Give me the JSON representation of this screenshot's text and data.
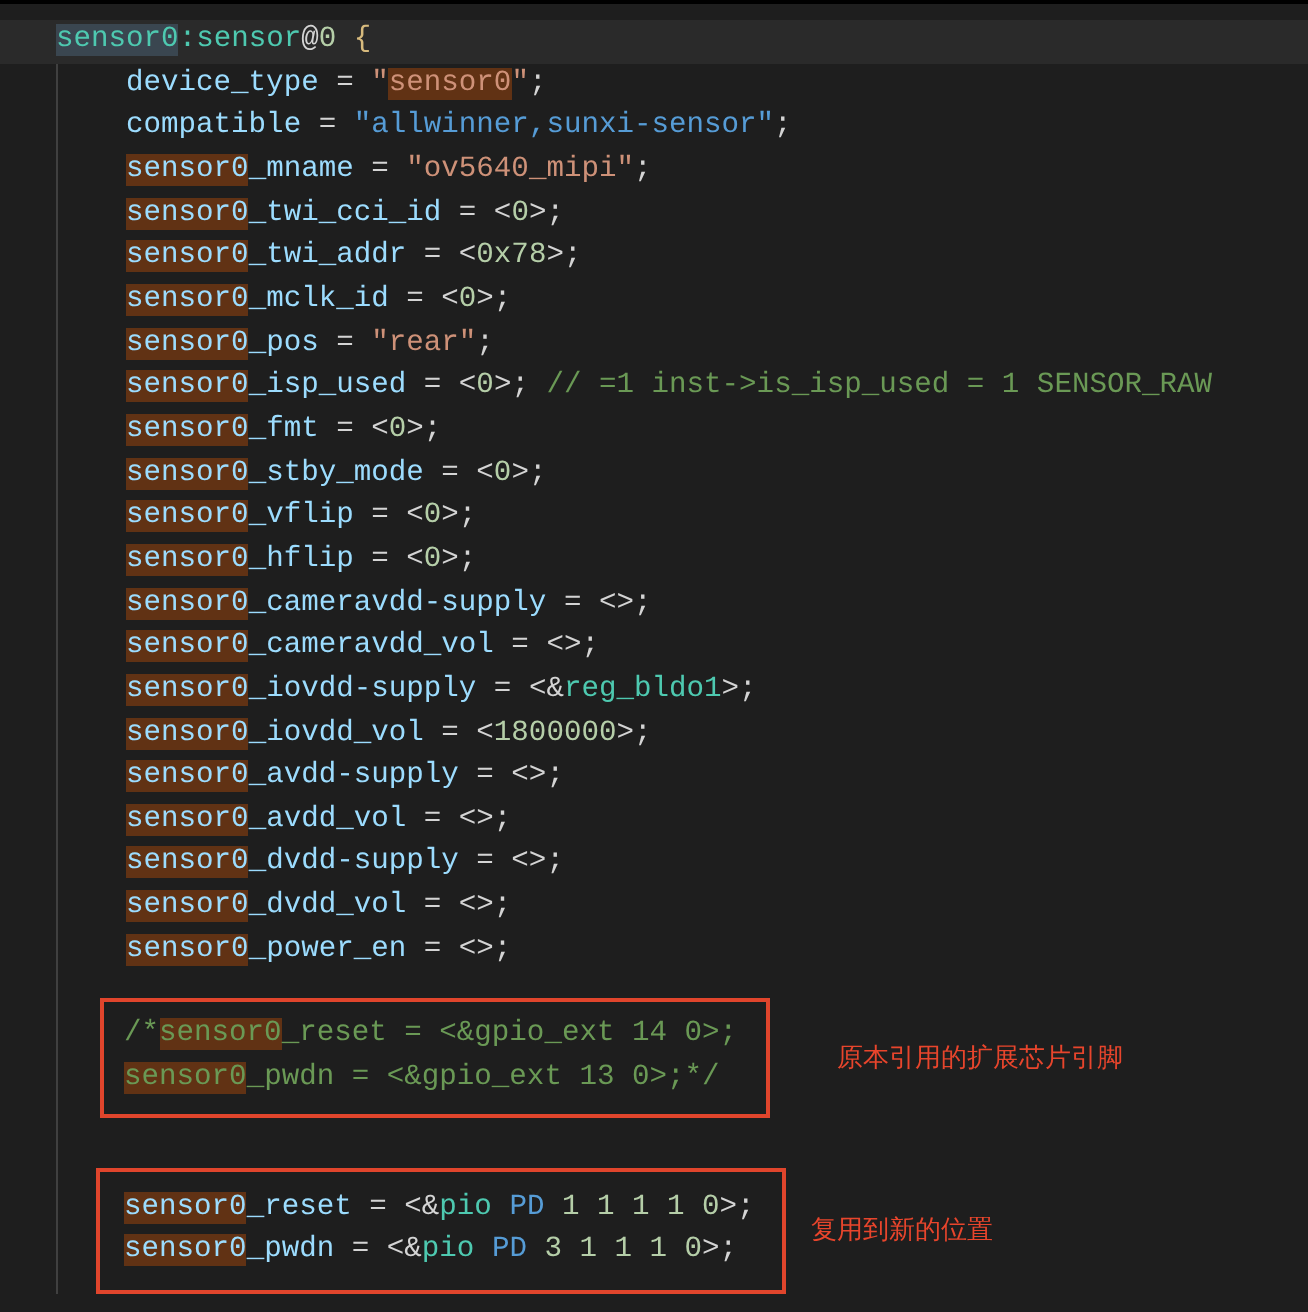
{
  "editor": {
    "header": {
      "current_line": true,
      "tokens": [
        {
          "text": "sensor0",
          "kind": "label",
          "highlighted": true
        },
        {
          "text": ":sensor",
          "kind": "label",
          "highlighted": false
        },
        {
          "text": "@",
          "kind": "punct",
          "highlighted": false
        },
        {
          "text": "0",
          "kind": "number",
          "highlighted": false
        },
        {
          "text": " {",
          "kind": "brace",
          "highlighted": false
        }
      ]
    },
    "lines": [
      {
        "tokens": [
          {
            "text": "device_type",
            "kind": "prop",
            "highlighted": false
          },
          {
            "text": " = ",
            "kind": "punct",
            "highlighted": false
          },
          {
            "text": "\"",
            "kind": "string",
            "highlighted": false
          },
          {
            "text": "sensor0",
            "kind": "string",
            "highlighted": true
          },
          {
            "text": "\"",
            "kind": "string",
            "highlighted": false
          },
          {
            "text": ";",
            "kind": "punct",
            "highlighted": false
          }
        ]
      },
      {
        "tokens": [
          {
            "text": "compatible",
            "kind": "prop",
            "highlighted": false
          },
          {
            "text": " = ",
            "kind": "punct",
            "highlighted": false
          },
          {
            "text": "\"allwinner,sunxi-sensor\"",
            "kind": "constant",
            "highlighted": false
          },
          {
            "text": ";",
            "kind": "punct",
            "highlighted": false
          }
        ]
      },
      {
        "tokens": [
          {
            "text": "sensor0",
            "kind": "prop",
            "highlighted": true
          },
          {
            "text": "_mname",
            "kind": "prop",
            "highlighted": false
          },
          {
            "text": " = ",
            "kind": "punct",
            "highlighted": false
          },
          {
            "text": "\"ov5640_mipi\"",
            "kind": "string",
            "highlighted": false
          },
          {
            "text": ";",
            "kind": "punct",
            "highlighted": false
          }
        ]
      },
      {
        "tokens": [
          {
            "text": "sensor0",
            "kind": "prop",
            "highlighted": true
          },
          {
            "text": "_twi_cci_id",
            "kind": "prop",
            "highlighted": false
          },
          {
            "text": " = <",
            "kind": "punct",
            "highlighted": false
          },
          {
            "text": "0",
            "kind": "number",
            "highlighted": false
          },
          {
            "text": ">;",
            "kind": "punct",
            "highlighted": false
          }
        ]
      },
      {
        "tokens": [
          {
            "text": "sensor0",
            "kind": "prop",
            "highlighted": true
          },
          {
            "text": "_twi_addr",
            "kind": "prop",
            "highlighted": false
          },
          {
            "text": " = <",
            "kind": "punct",
            "highlighted": false
          },
          {
            "text": "0x78",
            "kind": "number",
            "highlighted": false
          },
          {
            "text": ">;",
            "kind": "punct",
            "highlighted": false
          }
        ]
      },
      {
        "tokens": [
          {
            "text": "sensor0",
            "kind": "prop",
            "highlighted": true
          },
          {
            "text": "_mclk_id",
            "kind": "prop",
            "highlighted": false
          },
          {
            "text": " = <",
            "kind": "punct",
            "highlighted": false
          },
          {
            "text": "0",
            "kind": "number",
            "highlighted": false
          },
          {
            "text": ">;",
            "kind": "punct",
            "highlighted": false
          }
        ]
      },
      {
        "tokens": [
          {
            "text": "sensor0",
            "kind": "prop",
            "highlighted": true
          },
          {
            "text": "_pos",
            "kind": "prop",
            "highlighted": false
          },
          {
            "text": " = ",
            "kind": "punct",
            "highlighted": false
          },
          {
            "text": "\"rear\"",
            "kind": "string",
            "highlighted": false
          },
          {
            "text": ";",
            "kind": "punct",
            "highlighted": false
          }
        ]
      },
      {
        "tokens": [
          {
            "text": "sensor0",
            "kind": "prop",
            "highlighted": true
          },
          {
            "text": "_isp_used",
            "kind": "prop",
            "highlighted": false
          },
          {
            "text": " = <",
            "kind": "punct",
            "highlighted": false
          },
          {
            "text": "0",
            "kind": "number",
            "highlighted": false
          },
          {
            "text": ">; ",
            "kind": "punct",
            "highlighted": false
          },
          {
            "text": "// =1 inst->is_isp_used = 1 SENSOR_RAW",
            "kind": "comment",
            "highlighted": false
          }
        ]
      },
      {
        "tokens": [
          {
            "text": "sensor0",
            "kind": "prop",
            "highlighted": true
          },
          {
            "text": "_fmt",
            "kind": "prop",
            "highlighted": false
          },
          {
            "text": " = <",
            "kind": "punct",
            "highlighted": false
          },
          {
            "text": "0",
            "kind": "number",
            "highlighted": false
          },
          {
            "text": ">;",
            "kind": "punct",
            "highlighted": false
          }
        ]
      },
      {
        "tokens": [
          {
            "text": "sensor0",
            "kind": "prop",
            "highlighted": true
          },
          {
            "text": "_stby_mode",
            "kind": "prop",
            "highlighted": false
          },
          {
            "text": " = <",
            "kind": "punct",
            "highlighted": false
          },
          {
            "text": "0",
            "kind": "number",
            "highlighted": false
          },
          {
            "text": ">;",
            "kind": "punct",
            "highlighted": false
          }
        ]
      },
      {
        "tokens": [
          {
            "text": "sensor0",
            "kind": "prop",
            "highlighted": true
          },
          {
            "text": "_vflip",
            "kind": "prop",
            "highlighted": false
          },
          {
            "text": " = <",
            "kind": "punct",
            "highlighted": false
          },
          {
            "text": "0",
            "kind": "number",
            "highlighted": false
          },
          {
            "text": ">;",
            "kind": "punct",
            "highlighted": false
          }
        ]
      },
      {
        "tokens": [
          {
            "text": "sensor0",
            "kind": "prop",
            "highlighted": true
          },
          {
            "text": "_hflip",
            "kind": "prop",
            "highlighted": false
          },
          {
            "text": " = <",
            "kind": "punct",
            "highlighted": false
          },
          {
            "text": "0",
            "kind": "number",
            "highlighted": false
          },
          {
            "text": ">;",
            "kind": "punct",
            "highlighted": false
          }
        ]
      },
      {
        "tokens": [
          {
            "text": "sensor0",
            "kind": "prop",
            "highlighted": true
          },
          {
            "text": "_cameravdd-supply",
            "kind": "prop",
            "highlighted": false
          },
          {
            "text": " = <>;",
            "kind": "punct",
            "highlighted": false
          }
        ]
      },
      {
        "tokens": [
          {
            "text": "sensor0",
            "kind": "prop",
            "highlighted": true
          },
          {
            "text": "_cameravdd_vol",
            "kind": "prop",
            "highlighted": false
          },
          {
            "text": " = <>;",
            "kind": "punct",
            "highlighted": false
          }
        ]
      },
      {
        "tokens": [
          {
            "text": "sensor0",
            "kind": "prop",
            "highlighted": true
          },
          {
            "text": "_iovdd-supply",
            "kind": "prop",
            "highlighted": false
          },
          {
            "text": " = <&",
            "kind": "punct",
            "highlighted": false
          },
          {
            "text": "reg_bldo1",
            "kind": "ref",
            "highlighted": false
          },
          {
            "text": ">;",
            "kind": "punct",
            "highlighted": false
          }
        ]
      },
      {
        "tokens": [
          {
            "text": "sensor0",
            "kind": "prop",
            "highlighted": true
          },
          {
            "text": "_iovdd_vol",
            "kind": "prop",
            "highlighted": false
          },
          {
            "text": " = <",
            "kind": "punct",
            "highlighted": false
          },
          {
            "text": "1800000",
            "kind": "number",
            "highlighted": false
          },
          {
            "text": ">;",
            "kind": "punct",
            "highlighted": false
          }
        ]
      },
      {
        "tokens": [
          {
            "text": "sensor0",
            "kind": "prop",
            "highlighted": true
          },
          {
            "text": "_avdd-supply",
            "kind": "prop",
            "highlighted": false
          },
          {
            "text": " = <>;",
            "kind": "punct",
            "highlighted": false
          }
        ]
      },
      {
        "tokens": [
          {
            "text": "sensor0",
            "kind": "prop",
            "highlighted": true
          },
          {
            "text": "_avdd_vol",
            "kind": "prop",
            "highlighted": false
          },
          {
            "text": " = <>;",
            "kind": "punct",
            "highlighted": false
          }
        ]
      },
      {
        "tokens": [
          {
            "text": "sensor0",
            "kind": "prop",
            "highlighted": true
          },
          {
            "text": "_dvdd-supply",
            "kind": "prop",
            "highlighted": false
          },
          {
            "text": " = <>;",
            "kind": "punct",
            "highlighted": false
          }
        ]
      },
      {
        "tokens": [
          {
            "text": "sensor0",
            "kind": "prop",
            "highlighted": true
          },
          {
            "text": "_dvdd_vol",
            "kind": "prop",
            "highlighted": false
          },
          {
            "text": " = <>;",
            "kind": "punct",
            "highlighted": false
          }
        ]
      },
      {
        "tokens": [
          {
            "text": "sensor0",
            "kind": "prop",
            "highlighted": true
          },
          {
            "text": "_power_en",
            "kind": "prop",
            "highlighted": false
          },
          {
            "text": " = <>;",
            "kind": "punct",
            "highlighted": false
          }
        ]
      }
    ],
    "annotated_blocks": [
      {
        "note": "原本引用的扩展芯片引脚",
        "lines": [
          {
            "tokens": [
              {
                "text": "/*",
                "kind": "comment",
                "highlighted": false
              },
              {
                "text": "sensor0",
                "kind": "comment",
                "highlighted": true
              },
              {
                "text": "_reset = <&gpio_ext 14 0>;",
                "kind": "comment",
                "highlighted": false
              }
            ]
          },
          {
            "tokens": [
              {
                "text": "sensor0",
                "kind": "comment",
                "highlighted": true
              },
              {
                "text": "_pwdn = <&gpio_ext 13 0>;*/",
                "kind": "comment",
                "highlighted": false
              }
            ]
          }
        ]
      },
      {
        "note": "复用到新的位置",
        "lines": [
          {
            "tokens": [
              {
                "text": "sensor0",
                "kind": "prop",
                "highlighted": true
              },
              {
                "text": "_reset",
                "kind": "prop",
                "highlighted": false
              },
              {
                "text": " = <&",
                "kind": "punct",
                "highlighted": false
              },
              {
                "text": "pio",
                "kind": "ref",
                "highlighted": false
              },
              {
                "text": " PD",
                "kind": "constant",
                "highlighted": false
              },
              {
                "text": " 1 1 1 1 0",
                "kind": "number",
                "highlighted": false
              },
              {
                "text": ">;",
                "kind": "punct",
                "highlighted": false
              }
            ]
          },
          {
            "tokens": [
              {
                "text": "sensor0",
                "kind": "prop",
                "highlighted": true
              },
              {
                "text": "_pwdn",
                "kind": "prop",
                "highlighted": false
              },
              {
                "text": " = <&",
                "kind": "punct",
                "highlighted": false
              },
              {
                "text": "pio",
                "kind": "ref",
                "highlighted": false
              },
              {
                "text": " PD",
                "kind": "constant",
                "highlighted": false
              },
              {
                "text": " 3 1 1 1 0",
                "kind": "number",
                "highlighted": false
              },
              {
                "text": ">;",
                "kind": "punct",
                "highlighted": false
              }
            ]
          }
        ]
      }
    ]
  }
}
